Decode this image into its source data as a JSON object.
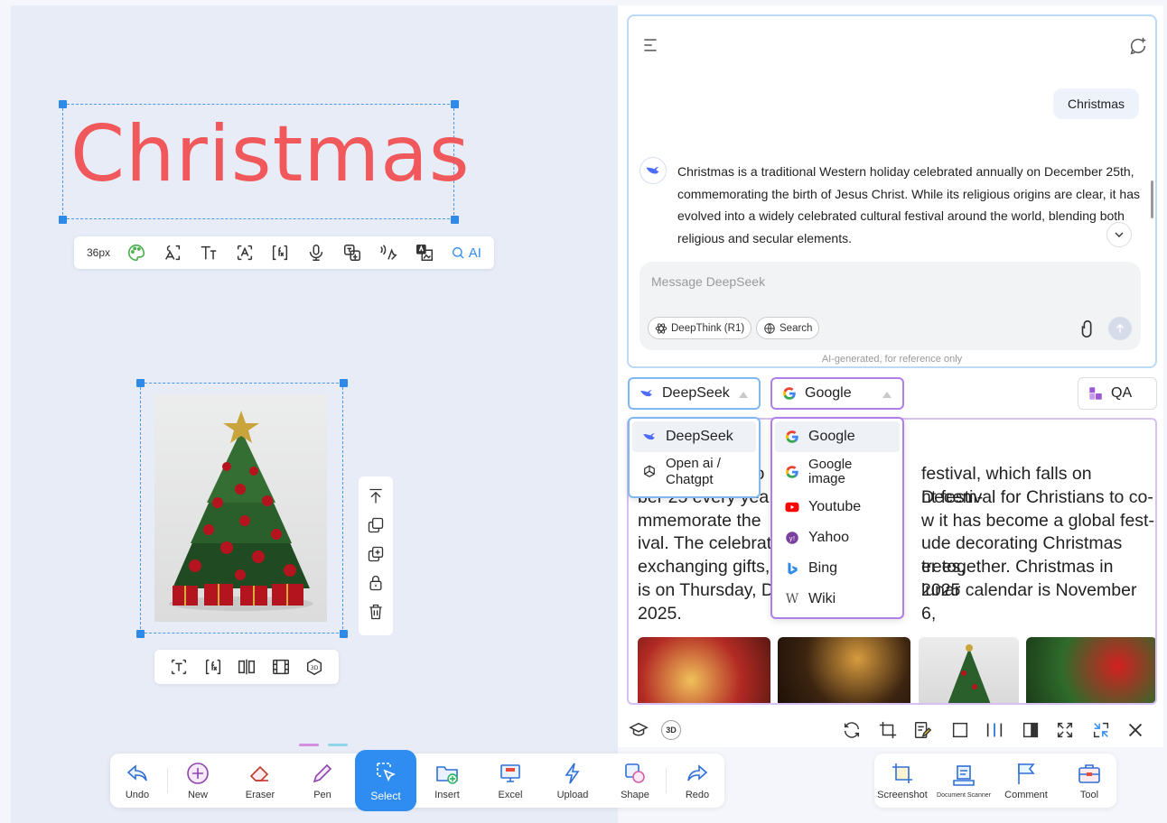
{
  "canvas": {
    "title_text": "Christmas",
    "text_toolbar": {
      "font_size": "36px",
      "ai_label": "AI"
    }
  },
  "chat": {
    "user_message": "Christmas",
    "answer": "Christmas is a traditional Western holiday celebrated annually on December 25th, commemorating the birth of Jesus Christ. While its religious origins are clear, it has evolved into a widely celebrated cultural festival around the world, blending both religious and secular elements.",
    "input_placeholder": "Message DeepSeek",
    "deepthink_label": "DeepThink (R1)",
    "search_label": "Search",
    "ai_note": "AI-generated, for reference only"
  },
  "selectors": {
    "model_label": "DeepSeek",
    "engine_label": "Google",
    "qa_label": "QA"
  },
  "model_dropdown": {
    "items": [
      "DeepSeek",
      "Open ai / Chatgpt"
    ]
  },
  "engine_dropdown": {
    "items": [
      "Google",
      "Google image",
      "Youtube",
      "Yahoo",
      "Bing",
      "Wiki"
    ]
  },
  "content": {
    "lines": [
      "festival, which falls on Decem-",
      "ber 25 every year ... nt festival for Christians to co-",
      "mmemorate the ... w it has become a global fest-",
      "ival. The celebrat ... ude decorating Christmas trees,",
      "exchanging gifts, ... er together. Christmas in 2025",
      "is on Thursday, D ... lunar calendar is November 6,",
      "2025."
    ],
    "line_left": [
      "",
      "ber 25 every yea",
      "mmemorate the",
      "ival. The celebrat",
      "exchanging gifts,",
      "is on Thursday, D",
      "2025."
    ],
    "line_right": [
      "festival, which falls on Decem-",
      "nt festival for Christians to co-",
      "w it has become a global fest-",
      "ude decorating Christmas trees,",
      "er together. Christmas in 2025",
      "lunar calendar is November 6,",
      ""
    ],
    "line_left_frag": "ro"
  },
  "bottom_toolbar": {
    "undo": "Undo",
    "new": "New",
    "eraser": "Eraser",
    "pen": "Pen",
    "select": "Select",
    "insert": "Insert",
    "excel": "Excel",
    "upload": "Upload",
    "shape": "Shape",
    "redo": "Redo"
  },
  "right_toolbar": {
    "screenshot": "Screenshot",
    "document_scanner": "Document Scanner",
    "comment": "Comment",
    "tool": "Tool"
  },
  "panel_icons": {
    "three_d": "3D"
  },
  "colors": {
    "accent": "#2f8cf0",
    "title_red": "#f0585c",
    "ai_blue": "#2f8cf0",
    "purple_border": "#b07ee8"
  }
}
